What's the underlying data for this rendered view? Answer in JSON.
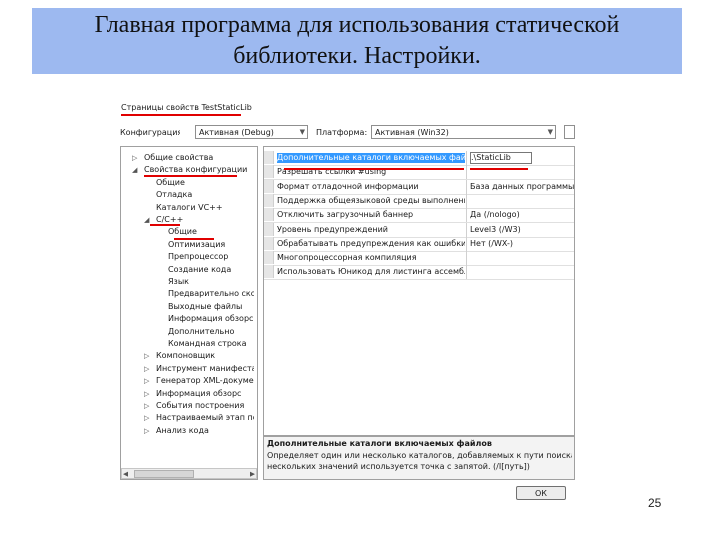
{
  "slide": {
    "title": "Главная программа для использования статической библиотеки. Настройки.",
    "page_number": "25"
  },
  "dialog": {
    "title": "Страницы свойств TestStaticLib",
    "config_label": "Конфигурация:",
    "config_value": "Активная (Debug)",
    "platform_label": "Платформа:",
    "platform_value": "Активная (Win32)",
    "tree": [
      {
        "label": "Общие свойства",
        "arrow": "▷"
      },
      {
        "label": "Свойства конфигурации",
        "arrow": "◢"
      },
      {
        "label": "Общие",
        "arrow": ""
      },
      {
        "label": "Отладка",
        "arrow": ""
      },
      {
        "label": "Каталоги VC++",
        "arrow": ""
      },
      {
        "label": "C/C++",
        "arrow": "◢"
      },
      {
        "label": "Общие",
        "arrow": ""
      },
      {
        "label": "Оптимизация",
        "arrow": ""
      },
      {
        "label": "Препроцессор",
        "arrow": ""
      },
      {
        "label": "Создание кода",
        "arrow": ""
      },
      {
        "label": "Язык",
        "arrow": ""
      },
      {
        "label": "Предварительно ско",
        "arrow": ""
      },
      {
        "label": "Выходные файлы",
        "arrow": ""
      },
      {
        "label": "Информация обзорс",
        "arrow": ""
      },
      {
        "label": "Дополнительно",
        "arrow": ""
      },
      {
        "label": "Командная строка",
        "arrow": ""
      },
      {
        "label": "Компоновщик",
        "arrow": "▷"
      },
      {
        "label": "Инструмент манифеста",
        "arrow": "▷"
      },
      {
        "label": "Генератор XML-докумен",
        "arrow": "▷"
      },
      {
        "label": "Информация обзорс",
        "arrow": "▷"
      },
      {
        "label": "События построения",
        "arrow": "▷"
      },
      {
        "label": "Настраиваемый этап пос",
        "arrow": "▷"
      },
      {
        "label": "Анализ кода",
        "arrow": "▷"
      }
    ],
    "properties": [
      {
        "name": "Дополнительные каталоги включаемых файлов",
        "value": ".\\StaticLib"
      },
      {
        "name": "Разрешать ссылки #using",
        "value": ""
      },
      {
        "name": "Формат отладочной информации",
        "value": "База данных программы дл"
      },
      {
        "name": "Поддержка общеязыковой среды выполнения (С",
        "value": ""
      },
      {
        "name": "Отключить загрузочный баннер",
        "value": "Да (/nologo)"
      },
      {
        "name": "Уровень предупреждений",
        "value": "Level3 (/W3)"
      },
      {
        "name": "Обрабатывать предупреждения как ошибки",
        "value": "Нет (/WX-)"
      },
      {
        "name": "Многопроцессорная компиляция",
        "value": ""
      },
      {
        "name": "Использовать Юникод для листинга ассемблера",
        "value": ""
      }
    ],
    "description_title": "Дополнительные каталоги включаемых файлов",
    "description_line1": "Определяет один или несколько каталогов, добавляемых к пути поиска включае",
    "description_line2": "нескольких значений используется точка с запятой.     (/I[путь])",
    "scroll_left": "◀",
    "scroll_right": "▶",
    "ok_label": "ОК",
    "dropdown_arrow": "▼"
  }
}
